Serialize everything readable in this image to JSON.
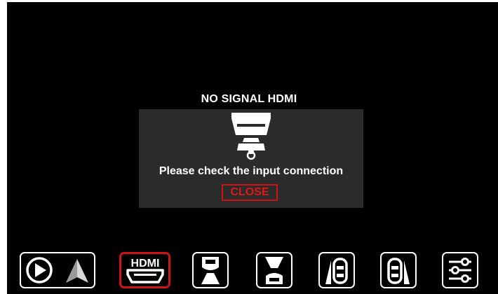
{
  "dialog": {
    "title": "NO SIGNAL HDMI",
    "message": "Please check the input connection",
    "close_label": "CLOSE",
    "icon": "hdmi-cable-icon"
  },
  "dock": {
    "items": [
      {
        "name": "carplay-android-auto",
        "icon": "carplay-android-auto-icon",
        "selected": false
      },
      {
        "name": "hdmi",
        "icon": "hdmi-icon",
        "label": "HDMI",
        "selected": true
      },
      {
        "name": "front-camera",
        "icon": "front-camera-icon",
        "selected": false
      },
      {
        "name": "rear-camera",
        "icon": "rear-camera-icon",
        "selected": false
      },
      {
        "name": "left-camera",
        "icon": "left-camera-icon",
        "selected": false
      },
      {
        "name": "right-camera",
        "icon": "right-camera-icon",
        "selected": false
      },
      {
        "name": "settings",
        "icon": "settings-sliders-icon",
        "selected": false
      }
    ]
  },
  "colors": {
    "background": "#000000",
    "dialog": "#2b2b2b",
    "accent": "#d01414",
    "text": "#ffffff"
  }
}
